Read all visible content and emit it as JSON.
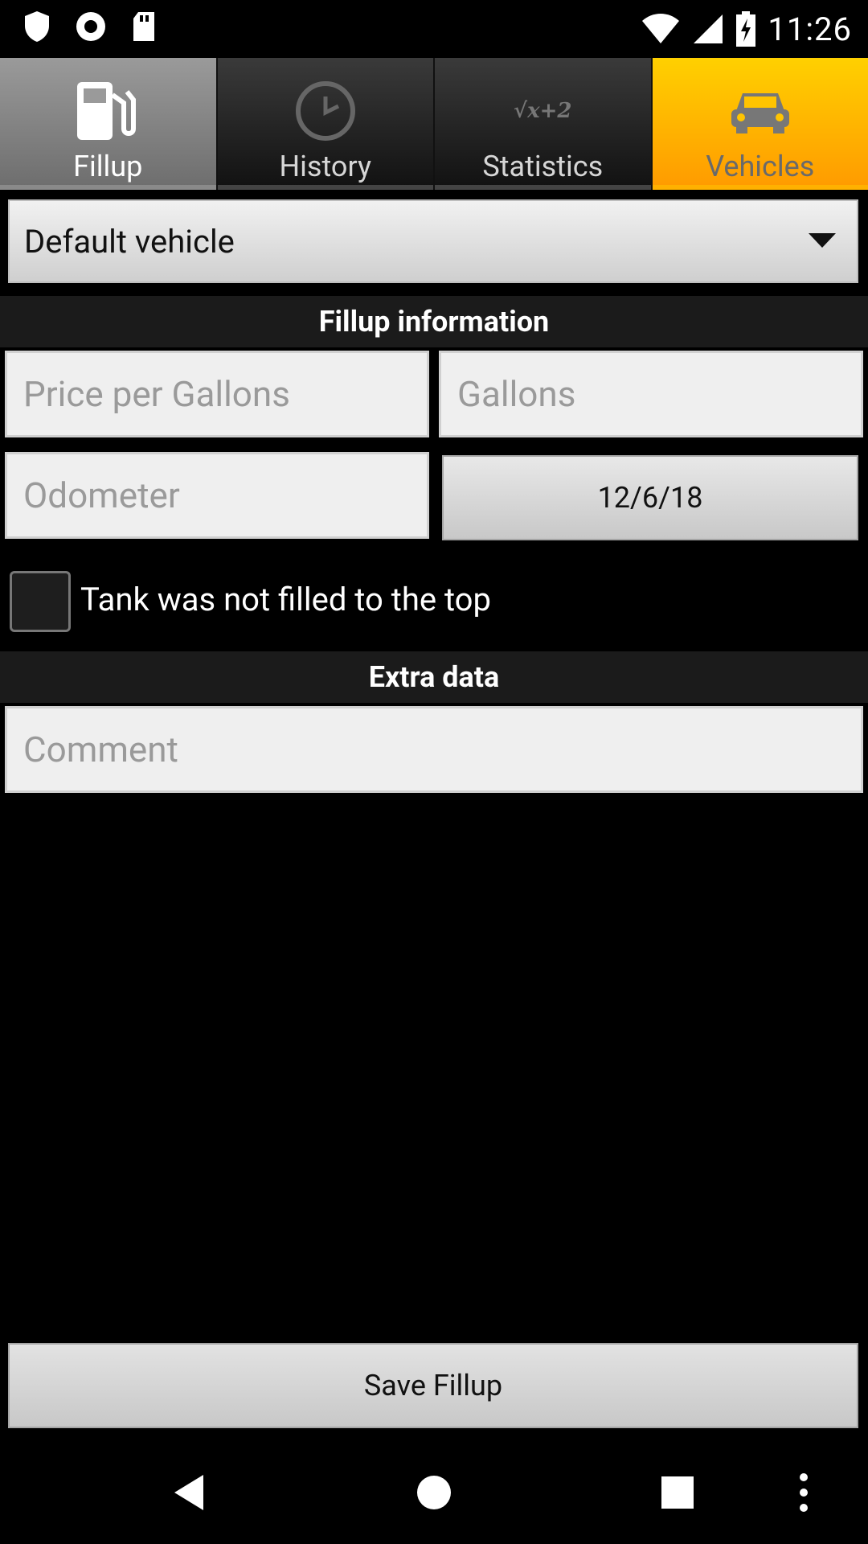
{
  "status_bar": {
    "time": "11:26",
    "left_icons": [
      "shield-icon",
      "record-icon",
      "sd-card-icon"
    ],
    "right_icons": [
      "wifi-icon",
      "cell-signal-icon",
      "battery-charging-icon"
    ]
  },
  "tabs": [
    {
      "label": "Fillup",
      "icon": "fuel-pump-icon"
    },
    {
      "label": "History",
      "icon": "clock-icon"
    },
    {
      "label": "Statistics",
      "icon": "formula-icon",
      "icon_text": "√x+2"
    },
    {
      "label": "Vehicles",
      "icon": "car-icon"
    }
  ],
  "vehicle_selector": {
    "value": "Default vehicle"
  },
  "sections": {
    "fillup_information": "Fillup information",
    "extra_data": "Extra data"
  },
  "fields": {
    "price_placeholder": "Price per Gallons",
    "gallons_placeholder": "Gallons",
    "odometer_placeholder": "Odometer",
    "date_value": "12/6/18",
    "comment_placeholder": "Comment"
  },
  "checkbox": {
    "label": "Tank was not filled to the top",
    "checked": false
  },
  "save_button": {
    "label": "Save Fillup"
  },
  "colors": {
    "accent_tab": "#ffb100",
    "selected_tab": "#8a8a8a"
  }
}
